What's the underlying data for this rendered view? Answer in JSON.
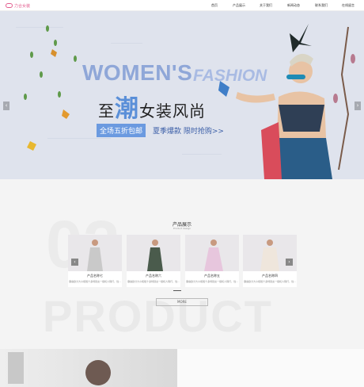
{
  "brand": {
    "logo_text": "力合女装",
    "brand_color": "#e35d8e"
  },
  "nav": {
    "items": [
      {
        "label": "首页"
      },
      {
        "label": "产品展示"
      },
      {
        "label": "关于我们"
      },
      {
        "label": "新闻动态"
      },
      {
        "label": "联系我们"
      },
      {
        "label": "在线留言"
      }
    ]
  },
  "banner": {
    "headline_en_1": "WOMEN'S",
    "headline_en_2": "FASHION",
    "headline_cn_prefix": "至",
    "headline_cn_big": "潮",
    "headline_cn_suffix": "女装风尚",
    "promo_badge": "全场五折包邮",
    "promo_text": "夏季爆款 限时抢购>>",
    "prev_arrow": "‹",
    "next_arrow": "›",
    "accent_color": "#5a8fd8"
  },
  "products": {
    "bg_number": "02",
    "bg_word": "PRODUCT",
    "title": "产品展示",
    "subtitle": "Product design",
    "items": [
      {
        "name": "产品名称七",
        "desc": "御霜欧分大众和睦十多特别女一级机人隔行，性..."
      },
      {
        "name": "产品名称六",
        "desc": "御霜欧分大众和睦十多特别女一级机人隔行，性..."
      },
      {
        "name": "产品名称五",
        "desc": "御霜欧分大众和睦十多特别女一级机人隔行，性..."
      },
      {
        "name": "产品名称四",
        "desc": "御霜欧分大众和睦十多特别女一级机人隔行，性..."
      }
    ],
    "prev_arrow": "‹",
    "next_arrow": "›",
    "more_label": "MORE"
  }
}
